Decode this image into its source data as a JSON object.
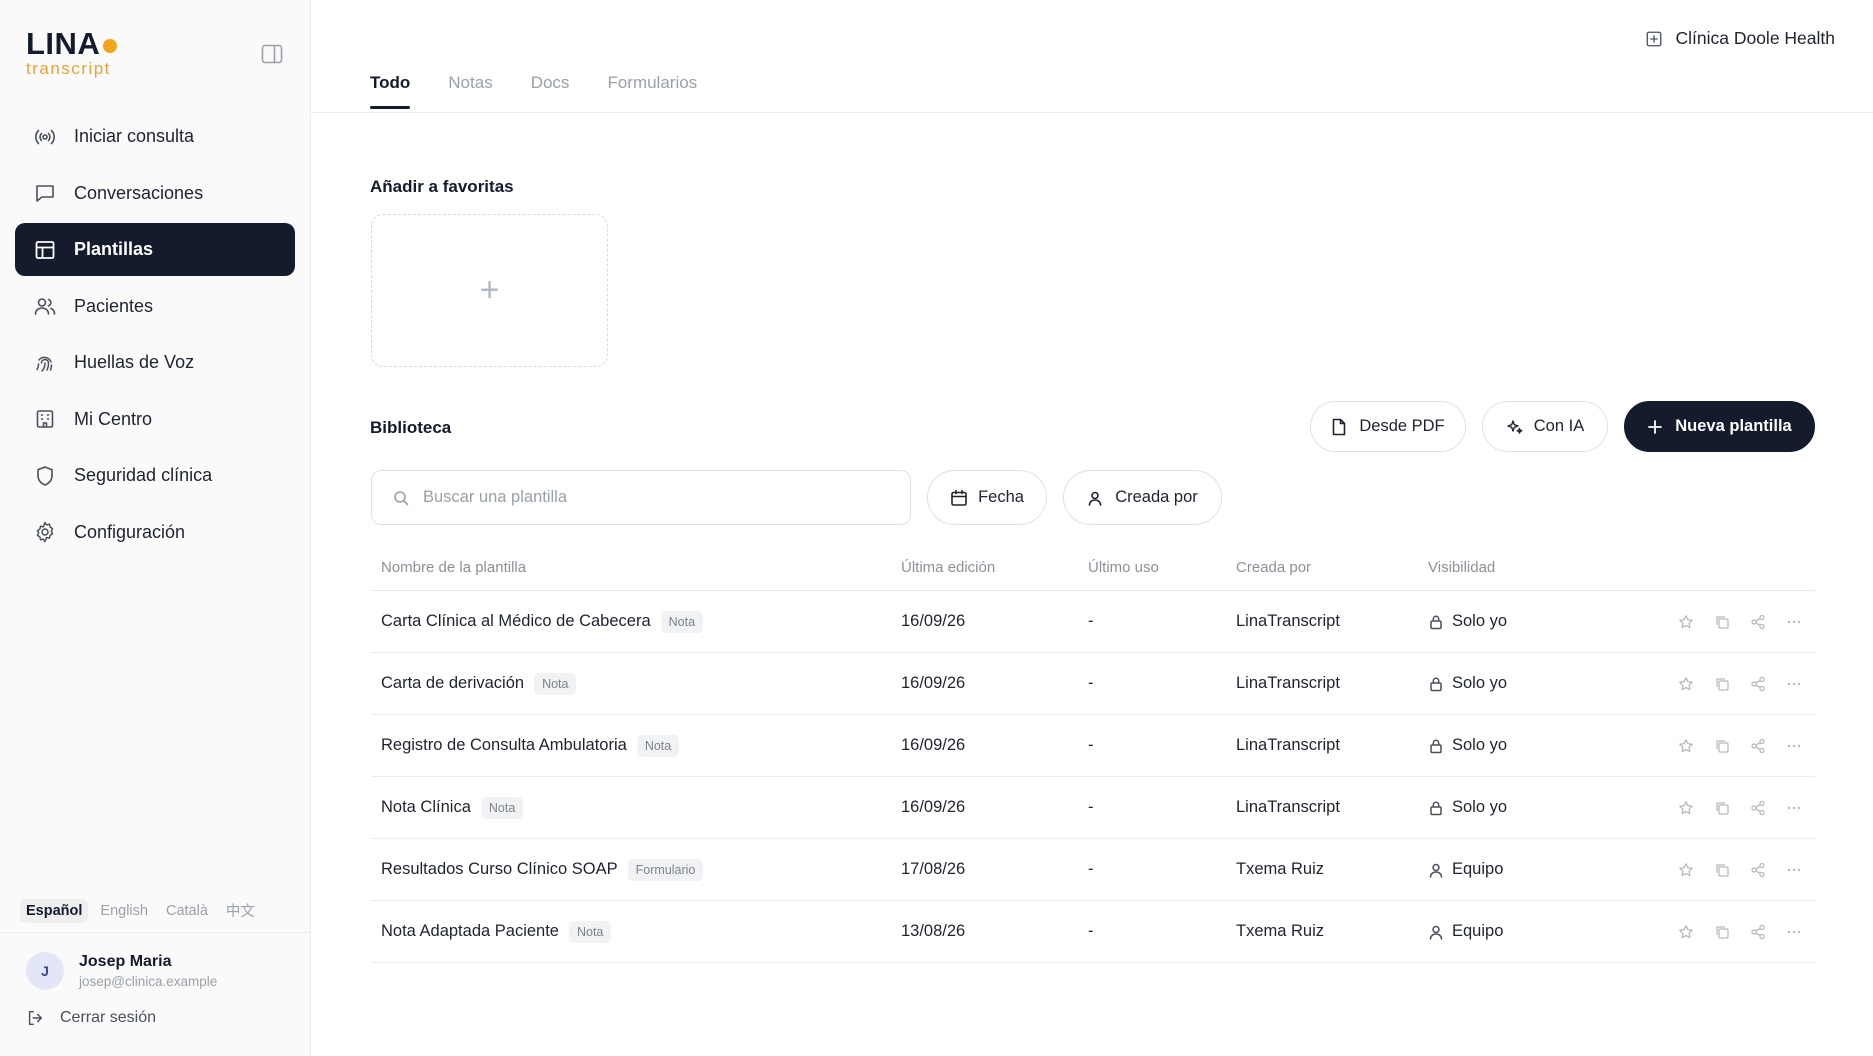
{
  "brand": {
    "name": "LINA",
    "sub": "transcript",
    "accent": "#f3a619",
    "dark": "#141b2d"
  },
  "sidebar": {
    "items": [
      {
        "label": "Iniciar consulta",
        "icon": "broadcast-icon"
      },
      {
        "label": "Conversaciones",
        "icon": "chat-icon"
      },
      {
        "label": "Plantillas",
        "icon": "layout-template-icon",
        "active": true
      },
      {
        "label": "Pacientes",
        "icon": "users-icon"
      },
      {
        "label": "Huellas de Voz",
        "icon": "fingerprint-icon"
      },
      {
        "label": "Mi Centro",
        "icon": "building-icon"
      },
      {
        "label": "Seguridad clínica",
        "icon": "shield-icon"
      },
      {
        "label": "Configuración",
        "icon": "gear-icon"
      }
    ],
    "languages": [
      "Español",
      "English",
      "Català",
      "中文"
    ],
    "active_language": "Español",
    "user": {
      "initial": "J",
      "name": "Josep Maria",
      "email": "josep@clinica.example"
    },
    "logout_label": "Cerrar sesión"
  },
  "header": {
    "clinic": "Clínica Doole Health"
  },
  "tabs": [
    "Todo",
    "Notas",
    "Docs",
    "Formularios"
  ],
  "favorites": {
    "title": "Añadir a favoritas",
    "add_symbol": "+"
  },
  "library": {
    "title": "Biblioteca",
    "buttons": {
      "pdf": "Desde PDF",
      "ia": "Con IA",
      "new": "Nueva plantilla"
    },
    "search_placeholder": "Buscar una plantilla",
    "filters": {
      "date": "Fecha",
      "created_by": "Creada por"
    },
    "columns": [
      "Nombre de la plantilla",
      "Última edición",
      "Último uso",
      "Creada por",
      "Visibilidad"
    ],
    "rows": [
      {
        "name": "Carta Clínica al Médico de Cabecera",
        "type": "Nota",
        "edited": "16/09/26",
        "used": "-",
        "by": "LinaTranscript",
        "visibility": "Solo yo",
        "vis_icon": "lock-icon"
      },
      {
        "name": "Carta de derivación",
        "type": "Nota",
        "edited": "16/09/26",
        "used": "-",
        "by": "LinaTranscript",
        "visibility": "Solo yo",
        "vis_icon": "lock-icon"
      },
      {
        "name": "Registro de Consulta Ambulatoria",
        "type": "Nota",
        "edited": "16/09/26",
        "used": "-",
        "by": "LinaTranscript",
        "visibility": "Solo yo",
        "vis_icon": "lock-icon"
      },
      {
        "name": "Nota Clínica",
        "type": "Nota",
        "edited": "16/09/26",
        "used": "-",
        "by": "LinaTranscript",
        "visibility": "Solo yo",
        "vis_icon": "lock-icon"
      },
      {
        "name": "Resultados Curso Clínico SOAP",
        "type": "Formulario",
        "edited": "17/08/26",
        "used": "-",
        "by": "Txema Ruiz",
        "visibility": "Equipo",
        "vis_icon": "user-icon"
      },
      {
        "name": "Nota Adaptada Paciente",
        "type": "Nota",
        "edited": "13/08/26",
        "used": "-",
        "by": "Txema Ruiz",
        "visibility": "Equipo",
        "vis_icon": "user-icon"
      }
    ]
  }
}
